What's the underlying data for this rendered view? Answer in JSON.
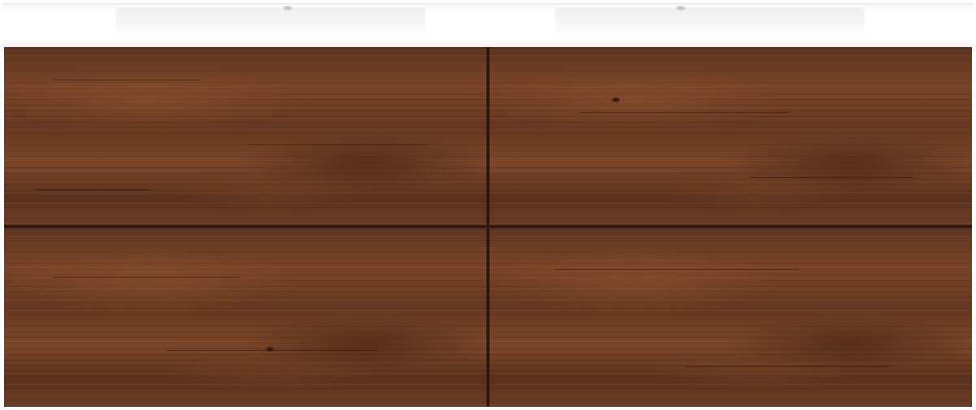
{
  "product": {
    "countertop_color": "#ffffff",
    "cabinet_finish_color": "#6b3c24",
    "drawer_count": 4,
    "basin_count": 2,
    "tap_hole_count": 2
  }
}
